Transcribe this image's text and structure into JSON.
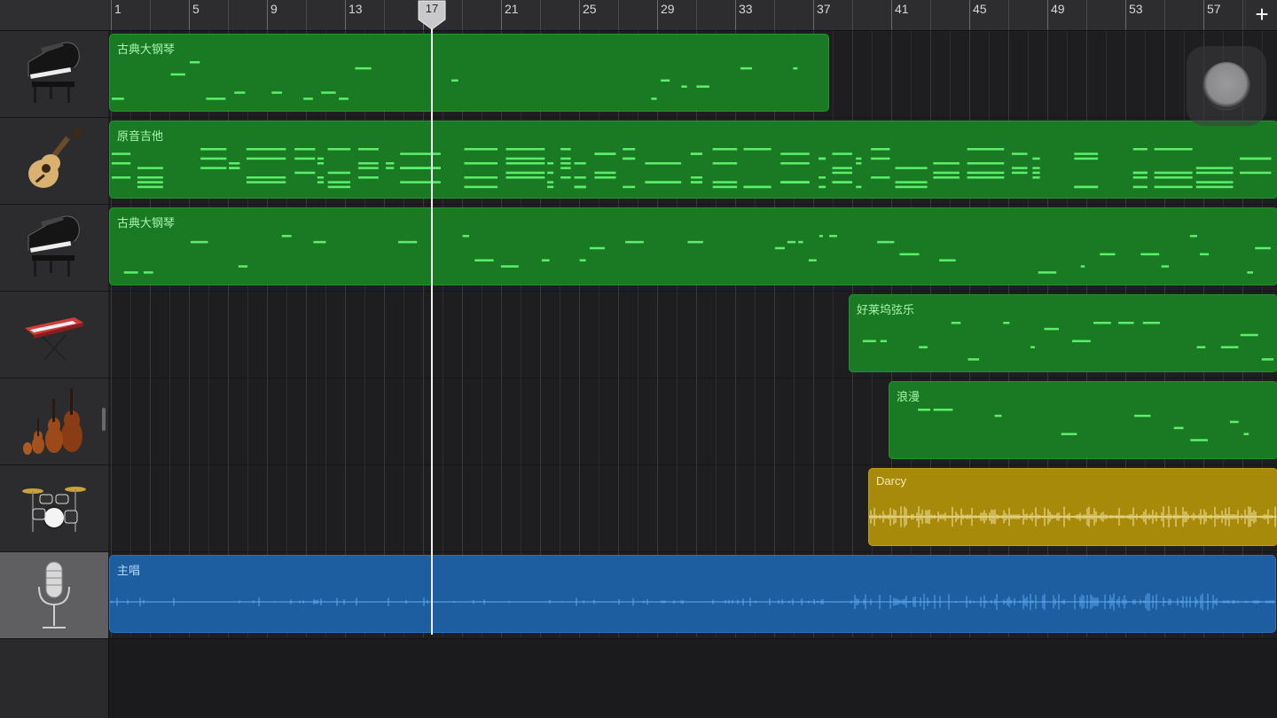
{
  "ruler": {
    "bar_labels": [
      "1",
      "5",
      "9",
      "13",
      "17",
      "21",
      "25",
      "29",
      "33",
      "37",
      "41",
      "45",
      "49",
      "53",
      "57"
    ],
    "add_button": "+"
  },
  "playhead": {
    "bar": "17"
  },
  "tracks": [
    {
      "instrument_icon": "grand-piano-icon",
      "selected": false,
      "region": {
        "name": "古典大钢琴",
        "type": "midi",
        "color": "#1a7a24"
      }
    },
    {
      "instrument_icon": "acoustic-guitar-icon",
      "selected": false,
      "region": {
        "name": "原音吉他",
        "type": "midi",
        "color": "#1a7a24"
      }
    },
    {
      "instrument_icon": "grand-piano-icon",
      "selected": false,
      "region": {
        "name": "古典大钢琴",
        "type": "midi",
        "color": "#1a7a24"
      }
    },
    {
      "instrument_icon": "synth-keyboard-icon",
      "selected": false,
      "region": {
        "name": "好莱坞弦乐",
        "type": "midi",
        "color": "#1a7a24"
      }
    },
    {
      "instrument_icon": "string-ensemble-icon",
      "selected": false,
      "region": {
        "name": "浪漫",
        "type": "midi",
        "color": "#1a7a24"
      }
    },
    {
      "instrument_icon": "drum-kit-icon",
      "selected": false,
      "region": {
        "name": "Darcy",
        "type": "drummer",
        "color": "#a88a0a"
      }
    },
    {
      "instrument_icon": "microphone-icon",
      "selected": true,
      "region": {
        "name": "主唱",
        "type": "audio",
        "color": "#1c5ea0"
      }
    }
  ]
}
